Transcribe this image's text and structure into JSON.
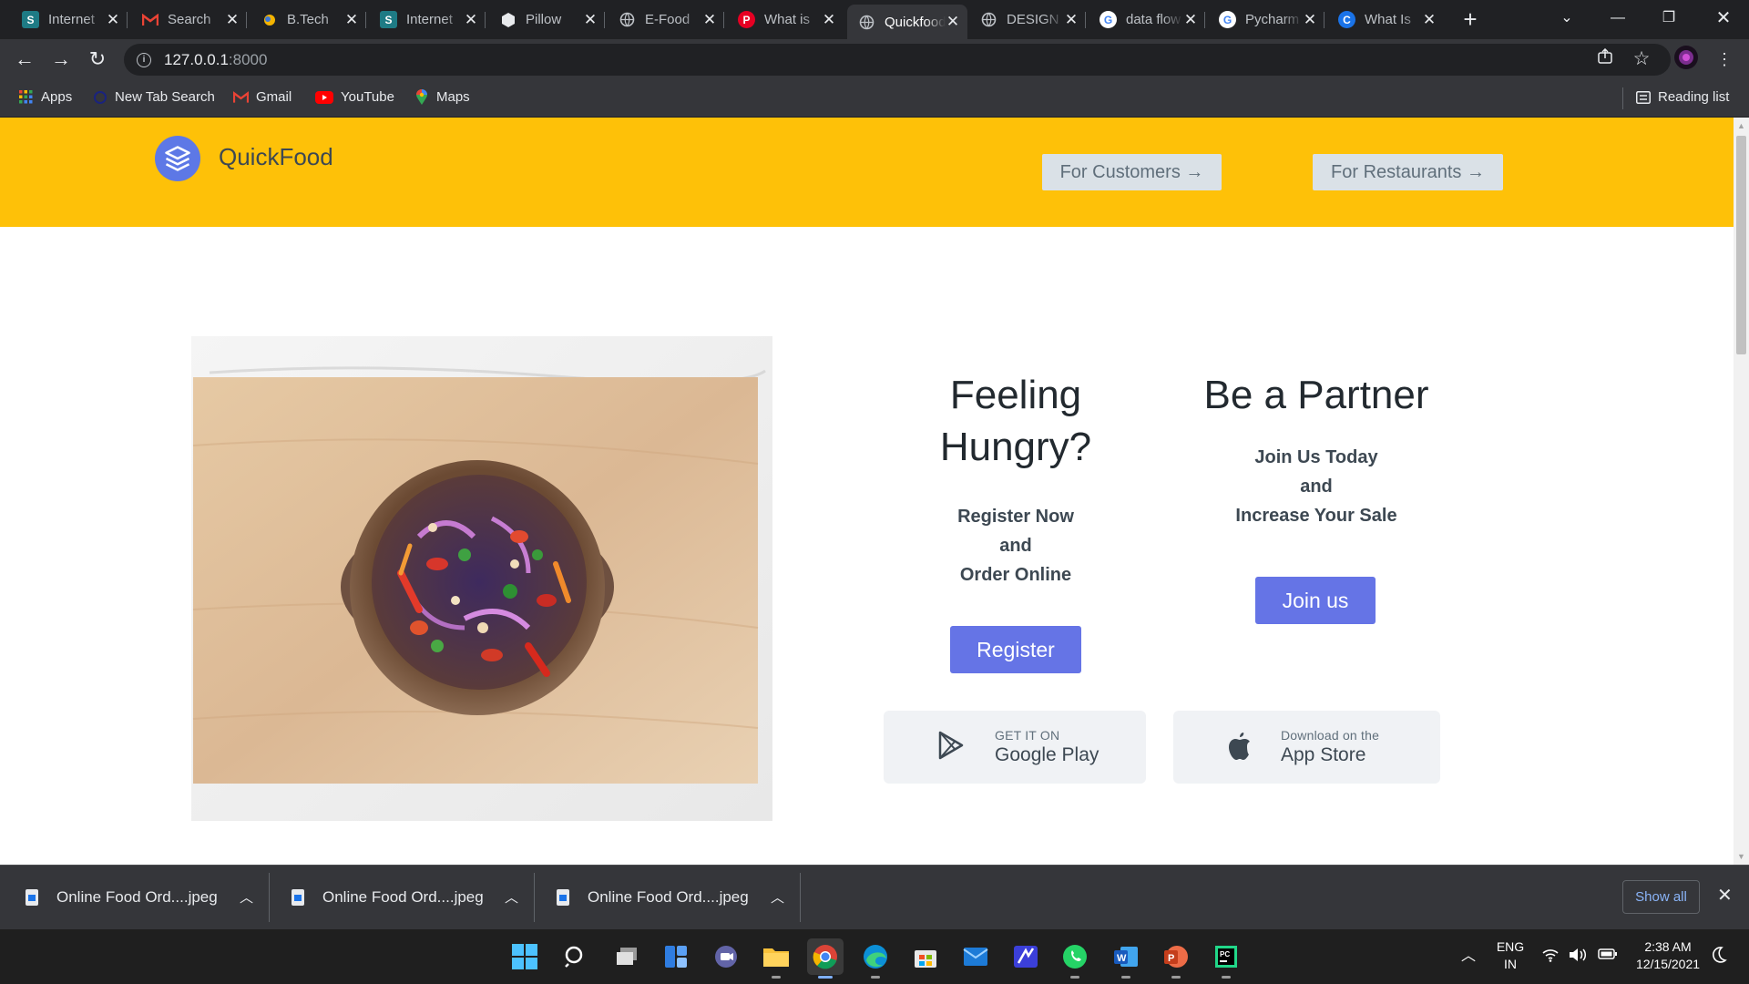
{
  "browser": {
    "tabs": [
      {
        "title": "Internet",
        "icon": "scribd-icon",
        "color": "#1e7b85",
        "glyph": "S"
      },
      {
        "title": "Search",
        "icon": "gmail-icon",
        "color": "#ea4335",
        "glyph": "M"
      },
      {
        "title": "B.Tech",
        "icon": "btech-icon",
        "color": "#f4b400",
        "glyph": ""
      },
      {
        "title": "Internet",
        "icon": "scribd-icon",
        "color": "#1e7b85",
        "glyph": "S"
      },
      {
        "title": "Pillow",
        "icon": "pillow-icon",
        "color": "#e8eaed",
        "glyph": ""
      },
      {
        "title": "E-Food",
        "icon": "globe-icon",
        "color": "#5f6368",
        "glyph": ""
      },
      {
        "title": "What is",
        "icon": "pinterest-icon",
        "color": "#e60023",
        "glyph": "P"
      },
      {
        "title": "Quickfood",
        "icon": "globe-icon",
        "color": "#5f6368",
        "glyph": "",
        "active": true
      },
      {
        "title": "DESIGN",
        "icon": "globe-icon",
        "color": "#5f6368",
        "glyph": ""
      },
      {
        "title": "data flow",
        "icon": "google-icon",
        "color": "#4285f4",
        "glyph": "G"
      },
      {
        "title": "Pycharm",
        "icon": "google-icon",
        "color": "#4285f4",
        "glyph": "G"
      },
      {
        "title": "What Is",
        "icon": "c-icon",
        "color": "#1a73e8",
        "glyph": "C"
      }
    ],
    "url_host": "127.0.0.1",
    "url_port": ":8000",
    "bookmarks": [
      {
        "label": "Apps",
        "icon": "apps-grid-icon"
      },
      {
        "label": "New Tab Search",
        "icon": "search-engine-icon"
      },
      {
        "label": "Gmail",
        "icon": "gmail-icon"
      },
      {
        "label": "YouTube",
        "icon": "youtube-icon"
      },
      {
        "label": "Maps",
        "icon": "maps-icon"
      }
    ],
    "reading_list": "Reading list"
  },
  "site": {
    "brand": "QuickFood",
    "nav": {
      "customers": "For Customers →",
      "restaurants": "For Restaurants →"
    },
    "customer": {
      "heading_1": "Feeling",
      "heading_2": "Hungry?",
      "line_1": "Register Now",
      "line_2": "and",
      "line_3": "Order Online",
      "button": "Register"
    },
    "partner": {
      "heading": "Be a Partner",
      "line_1": "Join Us Today",
      "line_2": "and",
      "line_3": "Increase Your Sale",
      "button": "Join us"
    },
    "google_play": {
      "small": "GET IT ON",
      "big": "Google Play"
    },
    "app_store": {
      "small": "Download on the",
      "big": "App Store"
    },
    "hero_image": "food-bowl-image"
  },
  "downloads": {
    "items": [
      "Online Food Ord....jpeg",
      "Online Food Ord....jpeg",
      "Online Food Ord....jpeg"
    ],
    "show_all": "Show all"
  },
  "taskbar": {
    "lang_1": "ENG",
    "lang_2": "IN",
    "time": "2:38 AM",
    "date": "12/15/2021"
  },
  "colors": {
    "header": "#fec108",
    "accent": "#6574e6",
    "nav_button": "#dae1e7"
  }
}
